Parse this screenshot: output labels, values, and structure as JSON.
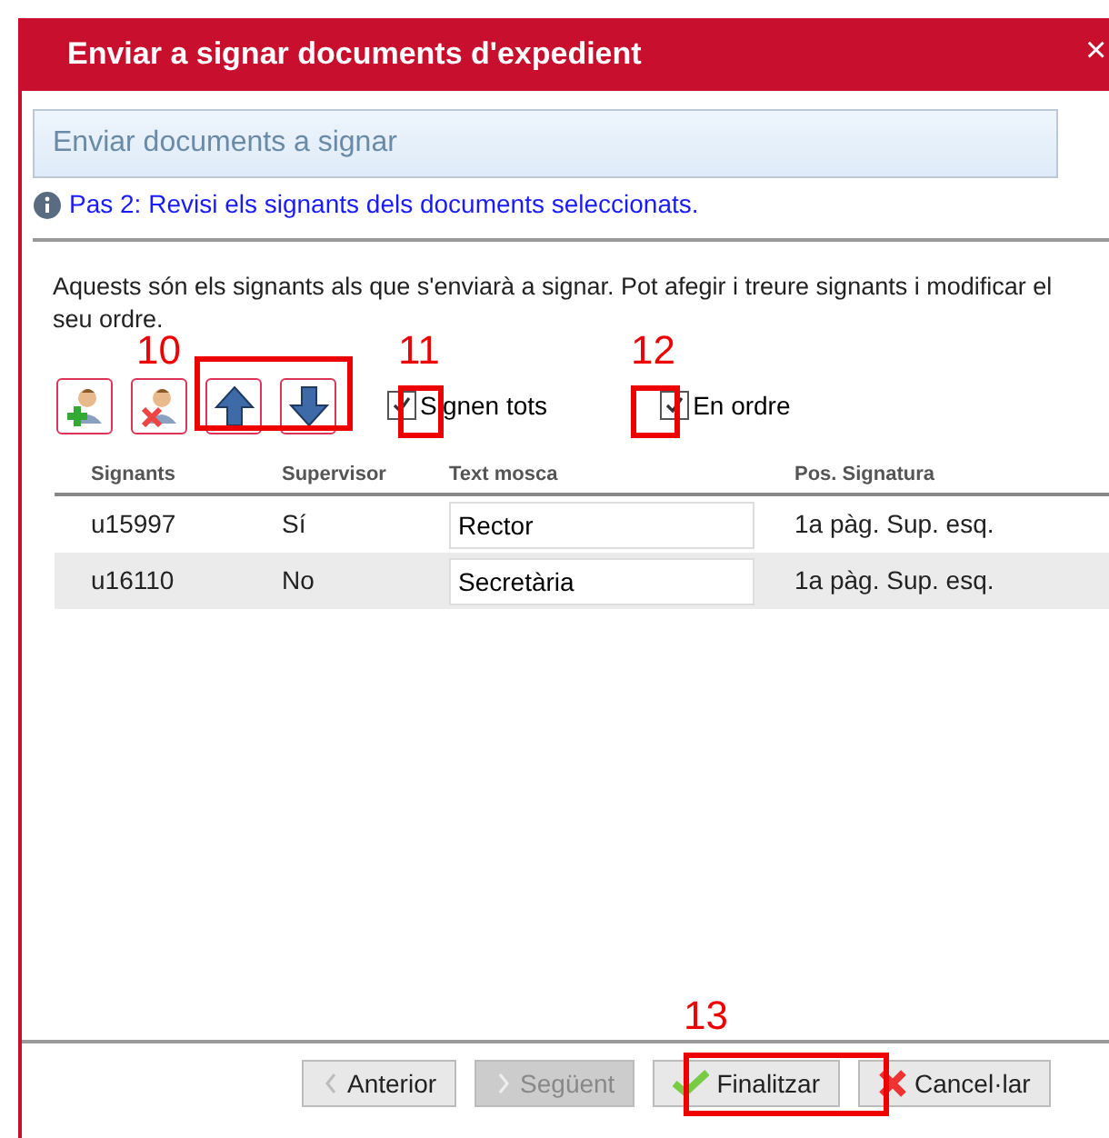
{
  "window": {
    "title": "Enviar a signar documents d'expedient",
    "close": "×"
  },
  "section_title": "Enviar documents a signar",
  "info": "Pas 2: Revisi els signants dels documents seleccionats.",
  "description": "Aquests són els signants als que s'enviarà a signar. Pot afegir i treure signants i modificar el seu ordre.",
  "toolbar": [
    {
      "kind": "add"
    },
    {
      "kind": "remove"
    },
    {
      "kind": "up"
    },
    {
      "kind": "down"
    }
  ],
  "options": [
    {
      "label": "Signen tots",
      "checked": true
    },
    {
      "label": "En ordre",
      "checked": true
    }
  ],
  "table": {
    "columns": [
      "Signants",
      "Supervisor",
      "Text mosca",
      "Pos. Signatura"
    ],
    "rows": [
      {
        "signant": "u15997",
        "supervisor": "Sí",
        "text_mosca": "Rector",
        "pos": "1a pàg. Sup. esq.",
        "selected": false
      },
      {
        "signant": "u16110",
        "supervisor": "No",
        "text_mosca": "Secretària",
        "pos": "1a pàg. Sup. esq.",
        "selected": true
      }
    ]
  },
  "buttons": [
    {
      "kind": "prev",
      "label": "Anterior",
      "disabled": false
    },
    {
      "kind": "next",
      "label": "Següent",
      "disabled": true
    },
    {
      "kind": "finish",
      "label": "Finalitzar",
      "disabled": false
    },
    {
      "kind": "cancel",
      "label": "Cancel·lar",
      "disabled": false
    }
  ],
  "callouts": [
    {
      "label": "10"
    },
    {
      "label": "11"
    },
    {
      "label": "12"
    },
    {
      "label": "13"
    }
  ]
}
